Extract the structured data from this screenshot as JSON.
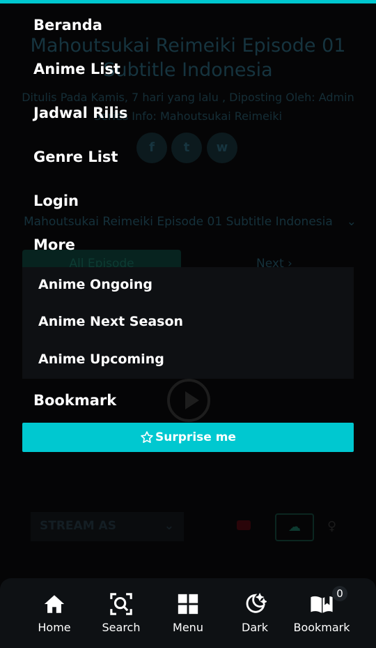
{
  "background": {
    "title": "Mahoutsukai Reimeiki Episode 01 Subtitle Indonesia",
    "meta_line1": "Ditulis Pada Kamis, 7 hari yang lalu , Diposting Oleh: Admin",
    "meta_line2": "Series Info: Mahoutsukai Reimeiki",
    "episode_select": "Mahoutsukai Reimeiki Episode 01 Subtitle Indonesia",
    "all_episode": "All Episode",
    "next": "Next ›",
    "stream_as": "STREAM AS"
  },
  "menu": {
    "items": [
      "Beranda",
      "Anime List",
      "Jadwal Rilis",
      "Genre List",
      "Login",
      "More"
    ],
    "submenu": [
      "Anime Ongoing",
      "Anime Next Season",
      "Anime Upcoming"
    ],
    "bookmark": "Bookmark",
    "surprise": "Surprise me"
  },
  "bottom_nav": {
    "home": "Home",
    "search": "Search",
    "menu": "Menu",
    "dark": "Dark",
    "bookmark": "Bookmark",
    "bookmark_count": "0"
  },
  "colors": {
    "accent": "#00c8d0",
    "background": "#050506",
    "nav_background": "#0e1114"
  }
}
